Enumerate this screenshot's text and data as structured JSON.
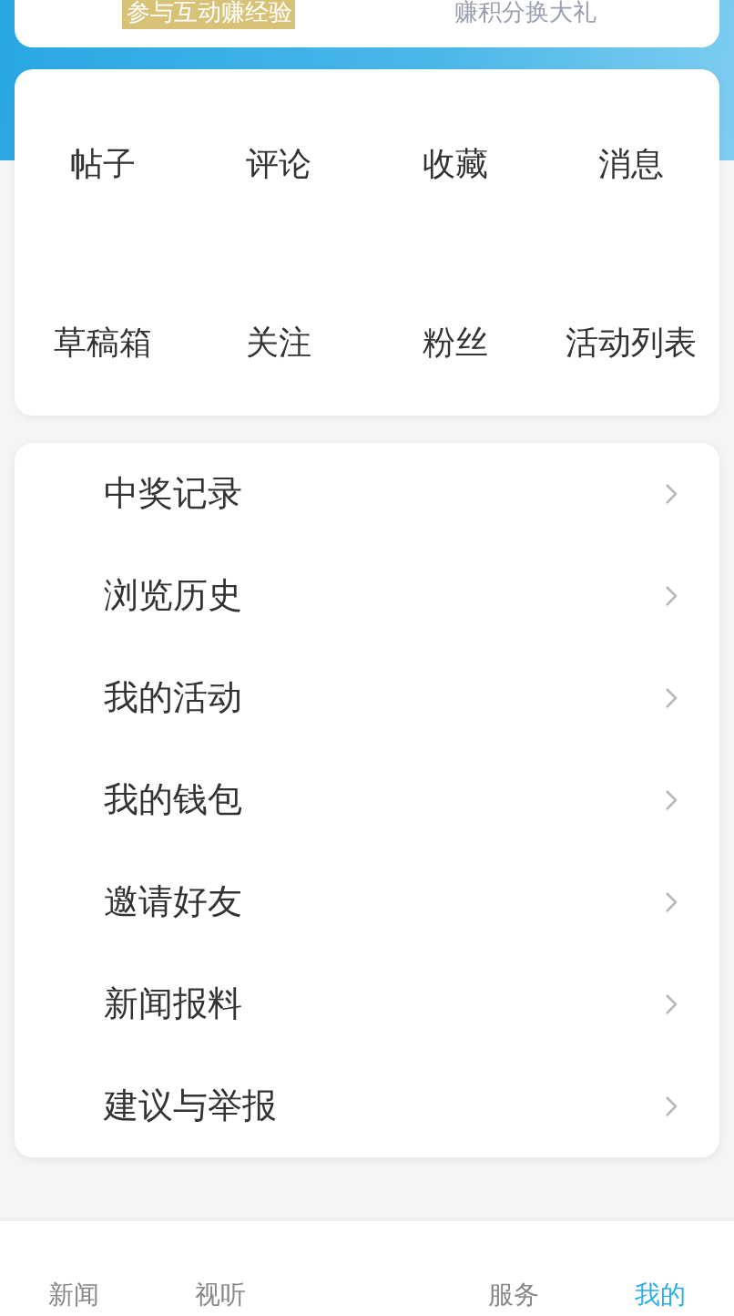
{
  "top_card": {
    "items": [
      {
        "text": "参与互动赚经验",
        "kind": "highlight"
      },
      {
        "text": "赚积分换大礼",
        "kind": "plain"
      }
    ]
  },
  "stats_grid": [
    "帖子",
    "评论",
    "收藏",
    "消息",
    "草稿箱",
    "关注",
    "粉丝",
    "活动列表"
  ],
  "menu": [
    "中奖记录",
    "浏览历史",
    "我的活动",
    "我的钱包",
    "邀请好友",
    "新闻报料",
    "建议与举报"
  ],
  "bottom_nav": [
    {
      "label": "新闻",
      "selected": false
    },
    {
      "label": "视听",
      "selected": false
    },
    {
      "label": "服务",
      "selected": false
    },
    {
      "label": "我的",
      "selected": true
    }
  ]
}
